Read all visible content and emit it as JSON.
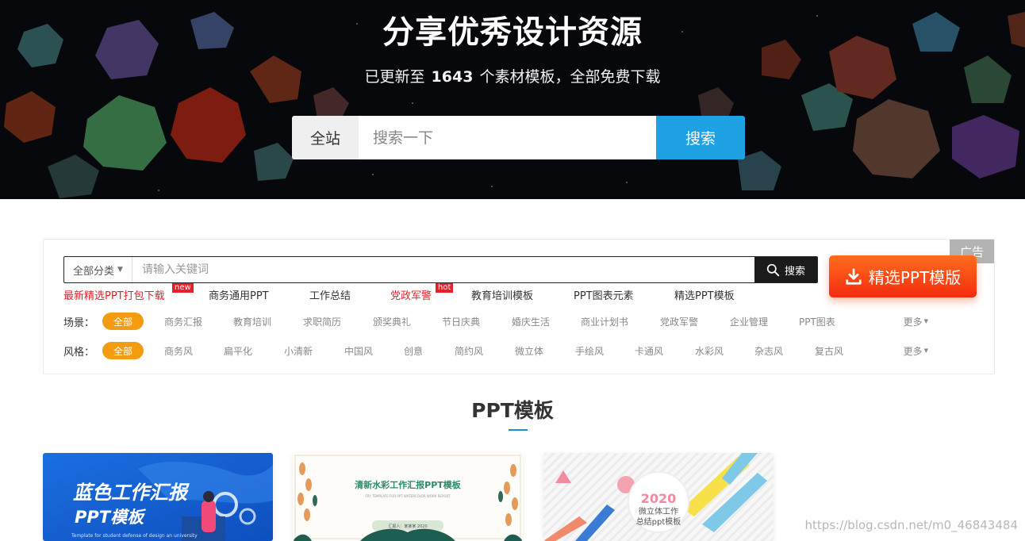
{
  "hero": {
    "title": "分享优秀设计资源",
    "subtitle_prefix": "已更新至",
    "count": "1643",
    "subtitle_suffix": "个素材模板，全部免费下载",
    "search": {
      "scope": "全站",
      "placeholder": "搜索一下",
      "button": "搜索"
    }
  },
  "filter": {
    "ad_label": "广告",
    "search": {
      "category": "全部分类",
      "placeholder": "请输入关键词",
      "button": "搜索"
    },
    "promo_button": "精选PPT模版",
    "hot_links": [
      {
        "label": "最新精选PPT打包下载",
        "badge": "new",
        "color": "#e5202a"
      },
      {
        "label": "商务通用PPT"
      },
      {
        "label": "工作总结"
      },
      {
        "label": "党政军警",
        "badge": "hot",
        "color": "#e5202a"
      },
      {
        "label": "教育培训模板"
      },
      {
        "label": "PPT图表元素"
      },
      {
        "label": "精选PPT模板"
      }
    ],
    "scene": {
      "label": "场景：",
      "items": [
        "全部",
        "商务汇报",
        "教育培训",
        "求职简历",
        "颁奖典礼",
        "节日庆典",
        "婚庆生活",
        "商业计划书",
        "党政军警",
        "企业管理",
        "PPT图表"
      ],
      "more": "更多"
    },
    "style": {
      "label": "风格：",
      "items": [
        "全部",
        "商务风",
        "扁平化",
        "小清新",
        "中国风",
        "创意",
        "简约风",
        "微立体",
        "手绘风",
        "卡通风",
        "水彩风",
        "杂志风",
        "复古风"
      ],
      "more": "更多"
    }
  },
  "section": {
    "title": "PPT模板"
  },
  "cards": [
    {
      "title_line1": "蓝色工作汇报",
      "title_line2": "PPT模板",
      "tagline": "Template for student defense of design an university"
    },
    {
      "title": "清新水彩工作汇报PPT模板",
      "subtitle": "FRY TEMPLATE FOR PPT WATERCOLOR WORK REPORT",
      "name_line": "汇报人：某某某 2020"
    },
    {
      "year": "2020",
      "line1": "微立体工作",
      "line2": "总结ppt模板"
    }
  ],
  "watermark": "https://blog.csdn.net/m0_46843484",
  "colors": {
    "accent_blue": "#1ea2e3",
    "active_chip": "#f39c12",
    "promo_red": "#f52b0e",
    "hot_red": "#e5202a"
  }
}
